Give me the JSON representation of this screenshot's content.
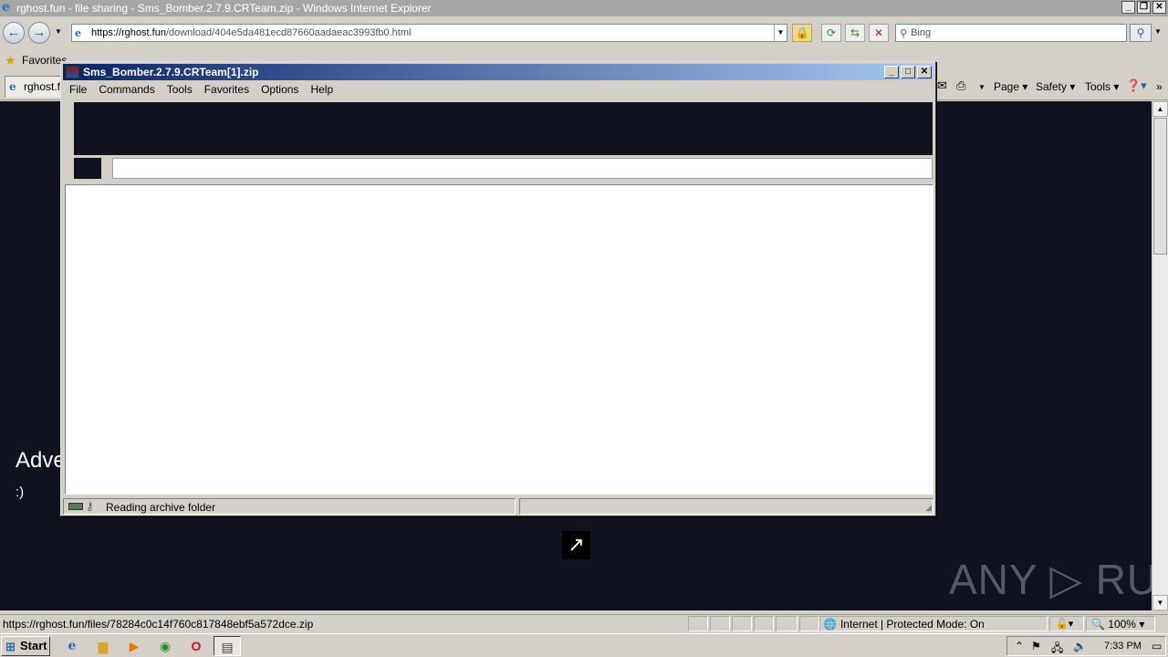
{
  "ie": {
    "window_title": "rghost.fun - file sharing - Sms_Bomber.2.7.9.CRTeam.zip - Windows Internet Explorer",
    "url_host": "https://rghost.fun",
    "url_path": "/download/404e5da481ecd87660aadaeac3993fb0.html",
    "search_placeholder": "Bing",
    "favorites_label": "Favorites",
    "tab_label": "rghost.f",
    "commands": {
      "page": "Page",
      "safety": "Safety",
      "tools": "Tools"
    },
    "status_url": "https://rghost.fun/files/78284c0c14f760c817848ebf5a572dce.zip",
    "zone": "Internet | Protected Mode: On",
    "zoom": "100%"
  },
  "page": {
    "adv_text": "Adve",
    "smiley": ":)",
    "watermark": "ANY ▷ RUN"
  },
  "rar": {
    "title": "Sms_Bomber.2.7.9.CRTeam[1].zip",
    "menu": [
      "File",
      "Commands",
      "Tools",
      "Favorites",
      "Options",
      "Help"
    ],
    "status_text": "Reading archive folder"
  },
  "taskbar": {
    "start_label": "Start",
    "clock": "7:33 PM"
  },
  "colors": {
    "page_background": "#10131f",
    "rar_title_gradient_start": "#0a246a",
    "rar_title_gradient_end": "#a6caf0"
  }
}
